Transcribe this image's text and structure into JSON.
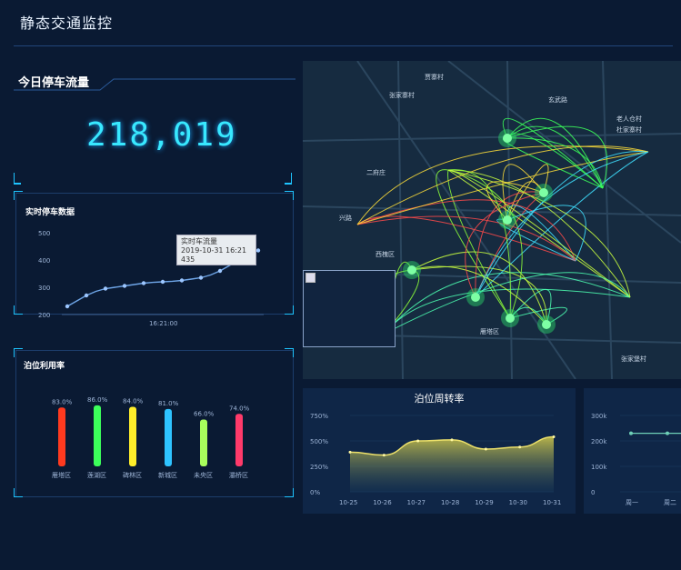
{
  "header": {
    "title": "静态交通监控"
  },
  "today_flow": {
    "label": "今日停车流量",
    "value": "218,019"
  },
  "realtime": {
    "title": "实时停车数据",
    "yticks": [
      "500",
      "400",
      "300",
      "200"
    ],
    "xtick": "16:21:00",
    "tooltip": {
      "title": "实时车流量",
      "time": "2019-10-31 16:21",
      "value": "435"
    }
  },
  "utilization": {
    "title": "泊位利用率",
    "bars": [
      {
        "label": "雁塔区",
        "value_text": "83.0%",
        "value": 83.0,
        "color": "#ff3a1f"
      },
      {
        "label": "莲湖区",
        "value_text": "86.0%",
        "value": 86.0,
        "color": "#3cff5a"
      },
      {
        "label": "碑林区",
        "value_text": "84.0%",
        "value": 84.0,
        "color": "#ffee2a"
      },
      {
        "label": "新城区",
        "value_text": "81.0%",
        "value": 81.0,
        "color": "#2ec3ff"
      },
      {
        "label": "未央区",
        "value_text": "66.0%",
        "value": 66.0,
        "color": "#a8ff5c"
      },
      {
        "label": "灞桥区",
        "value_text": "74.0%",
        "value": 74.0,
        "color": "#ff3a6a"
      }
    ]
  },
  "turnover": {
    "title": "泊位周转率",
    "yticks": [
      "750%",
      "500%",
      "250%",
      "0%"
    ],
    "x": [
      "10-25",
      "10-26",
      "10-27",
      "10-28",
      "10-29",
      "10-30",
      "10-31"
    ],
    "values": [
      390,
      360,
      500,
      510,
      420,
      440,
      540
    ]
  },
  "weekly": {
    "yticks": [
      "300k",
      "200k",
      "100k",
      "0"
    ],
    "x": [
      "周一",
      "周二"
    ],
    "values": [
      230,
      230
    ]
  },
  "map": {
    "labels": [
      "贾寨村",
      "张家寨村",
      "玄武路",
      "二府庄",
      "兴路",
      "西槐区",
      "老人仓村",
      "杜家寨村",
      "雁塔区",
      "张家堡村"
    ]
  },
  "chart_data": [
    {
      "type": "line",
      "title": "实时停车数据",
      "x": [
        "",
        "",
        "",
        "",
        "",
        "",
        "",
        "",
        "",
        "",
        "16:21:00",
        "",
        "",
        "",
        "",
        "",
        "",
        "",
        "",
        "",
        ""
      ],
      "values": [
        230,
        250,
        270,
        285,
        295,
        300,
        305,
        310,
        315,
        318,
        320,
        322,
        325,
        330,
        335,
        345,
        360,
        380,
        400,
        420,
        435
      ],
      "ylim": [
        200,
        500
      ]
    },
    {
      "type": "bar",
      "title": "泊位利用率",
      "categories": [
        "雁塔区",
        "莲湖区",
        "碑林区",
        "新城区",
        "未央区",
        "灞桥区"
      ],
      "values": [
        83.0,
        86.0,
        84.0,
        81.0,
        66.0,
        74.0
      ]
    },
    {
      "type": "area",
      "title": "泊位周转率",
      "x": [
        "10-25",
        "10-26",
        "10-27",
        "10-28",
        "10-29",
        "10-30",
        "10-31"
      ],
      "values": [
        390,
        360,
        500,
        510,
        420,
        440,
        540
      ],
      "ylim": [
        0,
        750
      ]
    }
  ]
}
